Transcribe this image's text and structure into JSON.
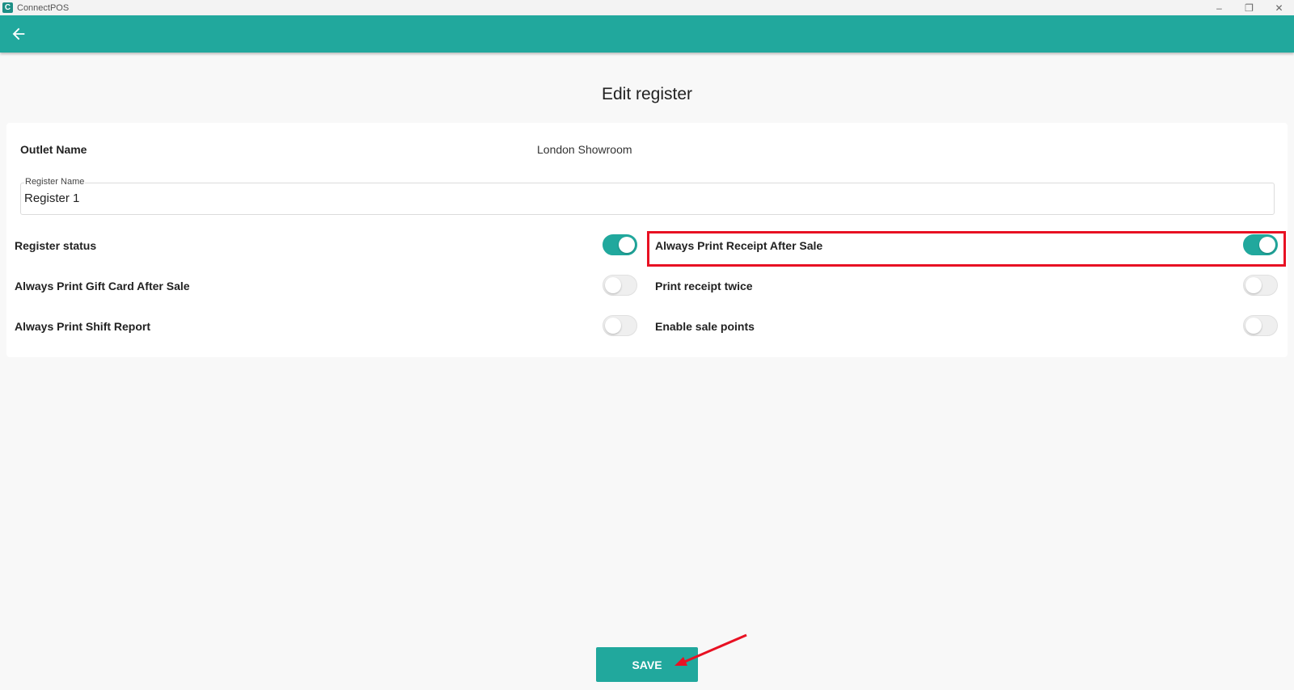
{
  "window": {
    "title": "ConnectPOS",
    "logo_text": "C",
    "minimize_glyph": "–",
    "restore_glyph": "❐",
    "close_glyph": "✕"
  },
  "appbar": {
    "back_icon": "arrow-left-icon"
  },
  "page": {
    "title": "Edit register"
  },
  "form": {
    "outlet_label": "Outlet Name",
    "outlet_value": "London Showroom",
    "register_name_label": "Register Name",
    "register_name_value": "Register 1"
  },
  "settings": {
    "register_status": {
      "label": "Register status",
      "on": true
    },
    "print_receipt_after_sale": {
      "label": "Always Print Receipt After Sale",
      "on": true
    },
    "print_gift_card_after_sale": {
      "label": "Always Print Gift Card After Sale",
      "on": false
    },
    "print_receipt_twice": {
      "label": "Print receipt twice",
      "on": false
    },
    "print_shift_report": {
      "label": "Always Print Shift Report",
      "on": false
    },
    "enable_sale_points": {
      "label": "Enable sale points",
      "on": false
    }
  },
  "actions": {
    "save_label": "SAVE"
  },
  "colors": {
    "primary": "#21a89d",
    "annotation": "#e81123"
  }
}
